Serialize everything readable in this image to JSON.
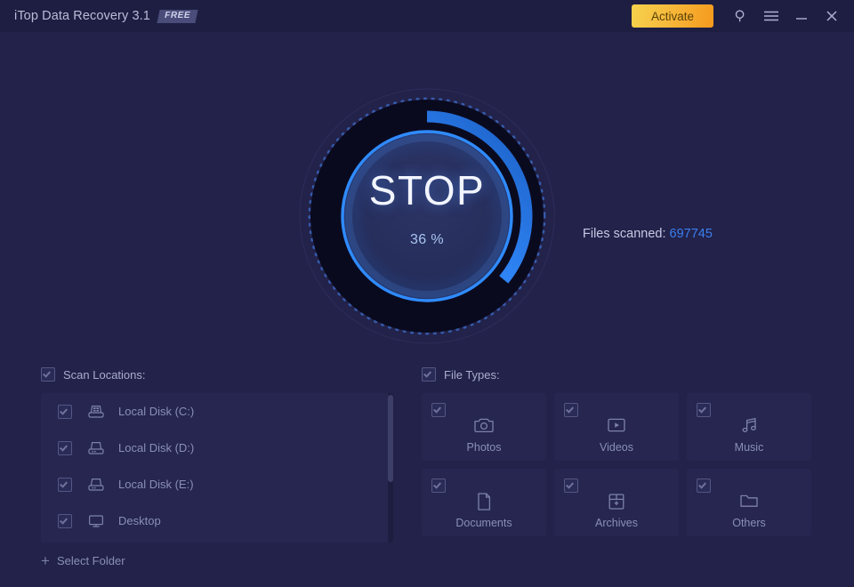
{
  "titlebar": {
    "app_title": "iTop Data Recovery 3.1",
    "badge": "FREE",
    "activate_label": "Activate",
    "icons": [
      "search-icon",
      "menu-icon",
      "minimize-icon",
      "close-icon"
    ]
  },
  "scan": {
    "stop_label": "STOP",
    "percent_label": "36 %",
    "percent_value": 36,
    "files_scanned_label": "Files scanned:",
    "files_scanned_value": "697745",
    "accent_color": "#2f7ff0",
    "count_color": "#3b7ef0"
  },
  "scan_locations": {
    "header": "Scan Locations:",
    "items": [
      {
        "label": "Local Disk (C:)",
        "icon": "windows-drive-icon",
        "checked": true
      },
      {
        "label": "Local Disk (D:)",
        "icon": "drive-icon",
        "checked": true
      },
      {
        "label": "Local Disk (E:)",
        "icon": "drive-icon",
        "checked": true
      },
      {
        "label": "Desktop",
        "icon": "monitor-icon",
        "checked": true
      }
    ],
    "select_folder_label": "Select Folder"
  },
  "file_types": {
    "header": "File Types:",
    "items": [
      {
        "label": "Photos",
        "icon": "camera-icon",
        "checked": true
      },
      {
        "label": "Videos",
        "icon": "video-icon",
        "checked": true
      },
      {
        "label": "Music",
        "icon": "music-note-icon",
        "checked": true
      },
      {
        "label": "Documents",
        "icon": "document-icon",
        "checked": true
      },
      {
        "label": "Archives",
        "icon": "archive-box-icon",
        "checked": true
      },
      {
        "label": "Others",
        "icon": "folder-icon",
        "checked": true
      }
    ]
  }
}
